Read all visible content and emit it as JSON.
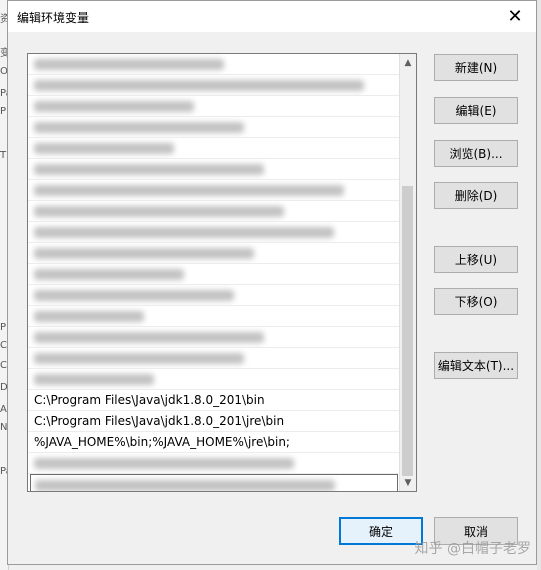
{
  "dialog": {
    "title": "编辑环境变量",
    "close_glyph": "✕"
  },
  "list": {
    "items": [
      {
        "text": "",
        "blurred": true
      },
      {
        "text": "",
        "blurred": true
      },
      {
        "text": "",
        "blurred": true
      },
      {
        "text": "",
        "blurred": true
      },
      {
        "text": "",
        "blurred": true
      },
      {
        "text": "",
        "blurred": true
      },
      {
        "text": "",
        "blurred": true
      },
      {
        "text": "",
        "blurred": true
      },
      {
        "text": "",
        "blurred": true
      },
      {
        "text": "",
        "blurred": true
      },
      {
        "text": "",
        "blurred": true
      },
      {
        "text": "",
        "blurred": true
      },
      {
        "text": "",
        "blurred": true
      },
      {
        "text": "",
        "blurred": true
      },
      {
        "text": "",
        "blurred": true
      },
      {
        "text": "",
        "blurred": true
      },
      {
        "text": "C:\\Program Files\\Java\\jdk1.8.0_201\\bin",
        "blurred": false
      },
      {
        "text": "C:\\Program Files\\Java\\jdk1.8.0_201\\jre\\bin",
        "blurred": false
      },
      {
        "text": "%JAVA_HOME%\\bin;%JAVA_HOME%\\jre\\bin;",
        "blurred": false
      },
      {
        "text": "",
        "blurred": true
      },
      {
        "text": "",
        "blurred": true,
        "editing": true
      }
    ]
  },
  "buttons": {
    "new": "新建(N)",
    "edit": "编辑(E)",
    "browse": "浏览(B)...",
    "delete": "删除(D)",
    "move_up": "上移(U)",
    "move_down": "下移(O)",
    "edit_text": "编辑文本(T)...",
    "ok": "确定",
    "cancel": "取消"
  },
  "watermark": "知乎 @白帽子老罗"
}
